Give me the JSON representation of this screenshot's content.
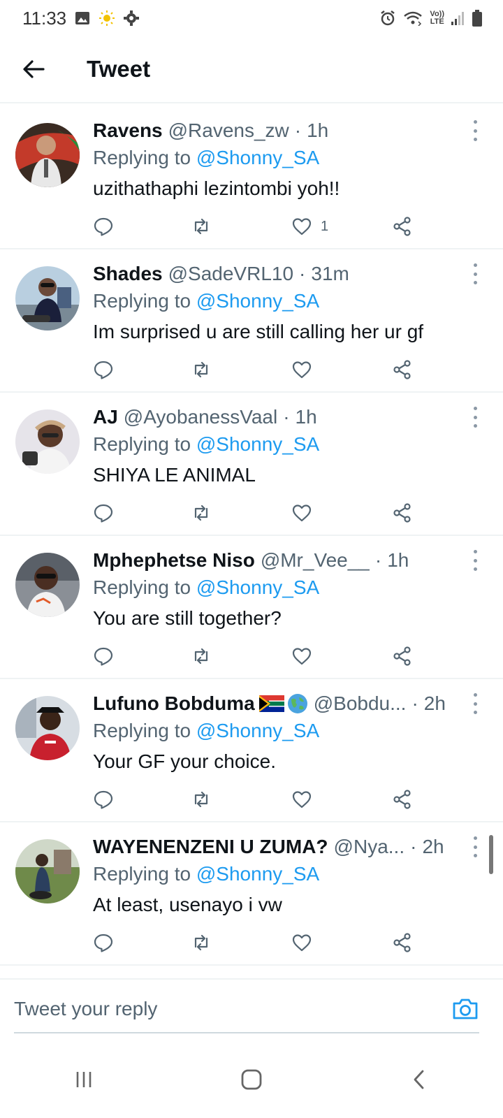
{
  "status_bar": {
    "time": "11:33",
    "left_icons": [
      "image-icon",
      "sun-icon",
      "gear-icon"
    ],
    "right_icons": [
      "alarm-icon",
      "wifi-icon",
      "volte-icon",
      "signal-icon",
      "battery-icon"
    ],
    "volte_label_top": "Vo))",
    "volte_label_bottom": "LTE"
  },
  "app_bar": {
    "title": "Tweet",
    "back_icon": "arrow-left-icon"
  },
  "replying_prefix": "Replying to",
  "tweets": [
    {
      "name": "Ravens",
      "handle": "@Ravens_zw",
      "time": "1h",
      "reply_to": "@Shonny_SA",
      "text": "uzithathaphi lezintombi yoh!!",
      "likes": "1"
    },
    {
      "name": "Shades",
      "handle": "@SadeVRL10",
      "time": "31m",
      "reply_to": "@Shonny_SA",
      "text": "Im surprised u are still calling her ur gf",
      "likes": ""
    },
    {
      "name": "AJ",
      "handle": "@AyobanessVaal",
      "time": "1h",
      "reply_to": "@Shonny_SA",
      "text": "SHIYA LE ANIMAL",
      "likes": ""
    },
    {
      "name": "Mphephetse Niso",
      "handle": "@Mr_Vee__",
      "time": "1h",
      "reply_to": "@Shonny_SA",
      "text": "You are still together?",
      "likes": ""
    },
    {
      "name": "Lufuno Bobduma",
      "handle": "@Bobdu...",
      "time": "2h",
      "reply_to": "@Shonny_SA",
      "text": "Your GF your choice.",
      "likes": "",
      "name_emojis": [
        "south-africa-flag-icon",
        "globe-icon"
      ]
    },
    {
      "name": "WAYENENZENI U ZUMA?",
      "handle": "@Nya...",
      "time": "2h",
      "reply_to": "@Shonny_SA",
      "text": "At least, usenayo i vw",
      "likes": ""
    }
  ],
  "separator": "·",
  "reply_bar": {
    "placeholder": "Tweet your reply"
  },
  "colors": {
    "accent": "#1d9bf0",
    "secondary_text": "#536471",
    "divider": "#eff3f4"
  }
}
